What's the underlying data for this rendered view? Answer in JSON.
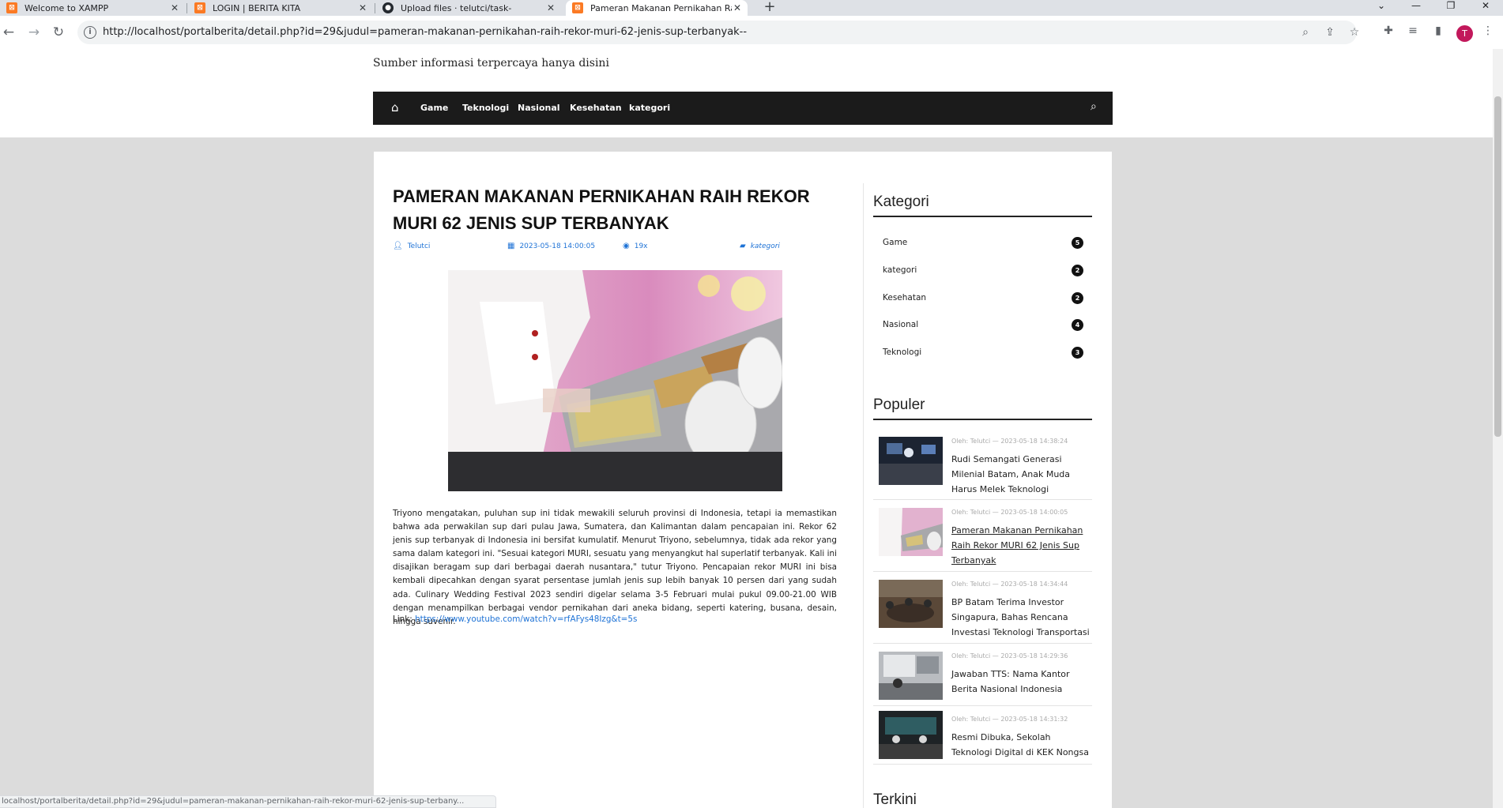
{
  "browser": {
    "tabs": [
      {
        "title": "Welcome to XAMPP",
        "favicon": "xampp-icon"
      },
      {
        "title": "LOGIN | BERITA KITA",
        "favicon": "xampp-icon"
      },
      {
        "title": "Upload files · telutci/task-",
        "favicon": "github-icon"
      },
      {
        "title": "Pameran Makanan Pernikahan Ra",
        "favicon": "xampp-icon",
        "active": true
      }
    ],
    "url": "http://localhost/portalberita/detail.php?id=29&judul=pameran-makanan-pernikahan-raih-rekor-muri-62-jenis-sup-terbanyak--",
    "profile_initial": "T",
    "status_url": "localhost/portalberita/detail.php?id=29&judul=pameran-makanan-pernikahan-raih-rekor-muri-62-jenis-sup-terbany..."
  },
  "site": {
    "tagline": "Sumber informasi terpercaya hanya disini",
    "nav": [
      "Game",
      "Teknologi",
      "Nasional",
      "Kesehatan",
      "kategori"
    ]
  },
  "article": {
    "title": "PAMERAN MAKANAN PERNIKAHAN RAIH REKOR MURI 62 JENIS SUP TERBANYAK",
    "author": "Telutci",
    "date": "2023-05-18 14:00:05",
    "views": "19x",
    "category": "kategori",
    "body": "Triyono mengatakan, puluhan sup ini tidak mewakili seluruh provinsi di Indonesia, tetapi ia memastikan bahwa ada perwakilan sup dari pulau Jawa, Sumatera, dan Kalimantan dalam pencapaian ini. Rekor 62 jenis sup terbanyak di Indonesia ini bersifat kumulatif. Menurut Triyono, sebelumnya, tidak ada rekor yang sama dalam kategori ini. \"Sesuai kategori MURI, sesuatu yang menyangkut hal superlatif terbanyak. Kali ini disajikan beragam sup dari berbagai daerah nusantara,\" tutur Triyono. Pencapaian rekor MURI ini bisa kembali dipecahkan dengan syarat persentase jumlah jenis sup lebih banyak 10 persen dari yang sudah ada. Culinary Wedding Festival 2023 sendiri digelar selama 3-5 Februari mulai pukul 09.00-21.00 WIB dengan menampilkan berbagai vendor pernikahan dari aneka bidang, seperti katering, busana, desain, hingga suvenir.",
    "link_label": "Link:",
    "link_url": "https://www.youtube.com/watch?v=rfAFys48Izg&t=5s"
  },
  "sidebar": {
    "kategori_heading": "Kategori",
    "categories": [
      {
        "name": "Game",
        "count": "5"
      },
      {
        "name": "kategori",
        "count": "2"
      },
      {
        "name": "Kesehatan",
        "count": "2"
      },
      {
        "name": "Nasional",
        "count": "4"
      },
      {
        "name": "Teknologi",
        "count": "3"
      }
    ],
    "populer_heading": "Populer",
    "populer": [
      {
        "meta": "Oleh: Telutci  —  2023-05-18 14:38:24",
        "title": "Rudi Semangati Generasi Milenial Batam, Anak Muda Harus Melek Teknologi"
      },
      {
        "meta": "Oleh: Telutci  —  2023-05-18 14:00:05",
        "title": "Pameran Makanan Pernikahan Raih Rekor MURI 62 Jenis Sup Terbanyak"
      },
      {
        "meta": "Oleh: Telutci  —  2023-05-18 14:34:44",
        "title": "BP Batam Terima Investor Singapura, Bahas Rencana Investasi Teknologi Transportasi"
      },
      {
        "meta": "Oleh: Telutci  —  2023-05-18 14:29:36",
        "title": "Jawaban TTS: Nama Kantor Berita Nasional Indonesia"
      },
      {
        "meta": "Oleh: Telutci  —  2023-05-18 14:31:32",
        "title": "Resmi Dibuka, Sekolah Teknologi Digital di KEK Nongsa"
      }
    ],
    "terkini_heading": "Terkini"
  },
  "colors": {
    "accent_link": "#1f73d6",
    "navbar": "#1b1b1b",
    "page_bg": "#dcdcdc"
  }
}
